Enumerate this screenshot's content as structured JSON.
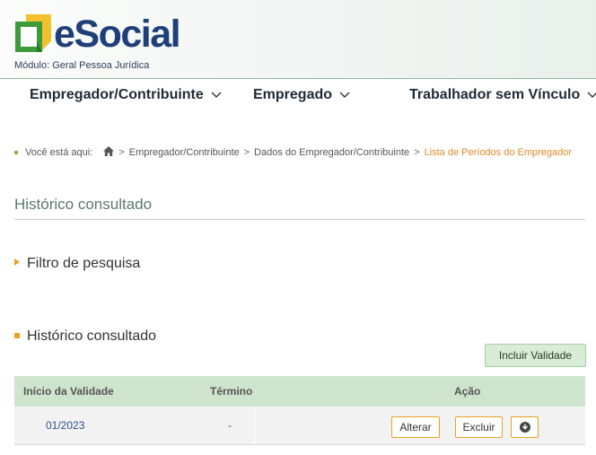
{
  "app": {
    "logo_text": "eSocial",
    "module": "Módulo: Geral Pessoa Jurídica"
  },
  "nav": {
    "items": [
      {
        "label": "Empregador/Contribuinte"
      },
      {
        "label": "Empregado"
      },
      {
        "label": "Trabalhador sem Vínculo"
      }
    ]
  },
  "breadcrumb": {
    "prefix": "Você está aqui:",
    "items": [
      {
        "label": "Empregador/Contribuinte"
      },
      {
        "label": "Dados do Empregador/Contribuinte"
      },
      {
        "label": "Lista de Períodos do Empregador"
      }
    ]
  },
  "page": {
    "title": "Histórico consultado",
    "filter_label": "Filtro de pesquisa",
    "section_title": "Histórico consultado",
    "add_button": "Incluir Validade"
  },
  "table": {
    "columns": [
      "Início da Validade",
      "Término",
      "Ação"
    ],
    "rows": [
      {
        "inicio": "01/2023",
        "termino": "-",
        "actions": {
          "edit": "Alterar",
          "delete": "Excluir"
        }
      }
    ]
  },
  "colors": {
    "brand_blue": "#1e3f7a",
    "accent_orange": "#e8a21c",
    "table_header": "#cfe4cc"
  }
}
